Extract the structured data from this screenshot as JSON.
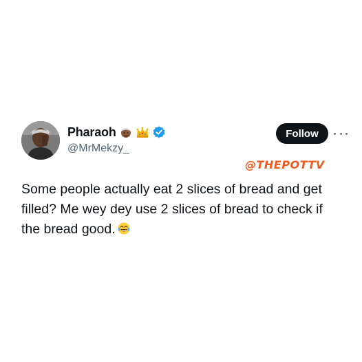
{
  "tweet": {
    "display_name": "Pharaoh",
    "handle": "@MrMekzy_",
    "follow_label": "Follow",
    "watermark": "@THEPOTTV",
    "text": "Some people actually eat 2 slices of bread and get filled? Me wey dey use 2 slices of bread to check if the bread good.",
    "name_icons": [
      "man-with-turban-emoji-icon",
      "crown-emoji-icon",
      "verified-badge-icon"
    ],
    "text_emoji": "face-with-tears-of-joy-emoji-icon",
    "colors": {
      "follow_button_bg": "#0f1419",
      "verified_blue": "#1d9bf0",
      "handle_gray": "#536471",
      "watermark_orange": "#f25a1d"
    }
  }
}
